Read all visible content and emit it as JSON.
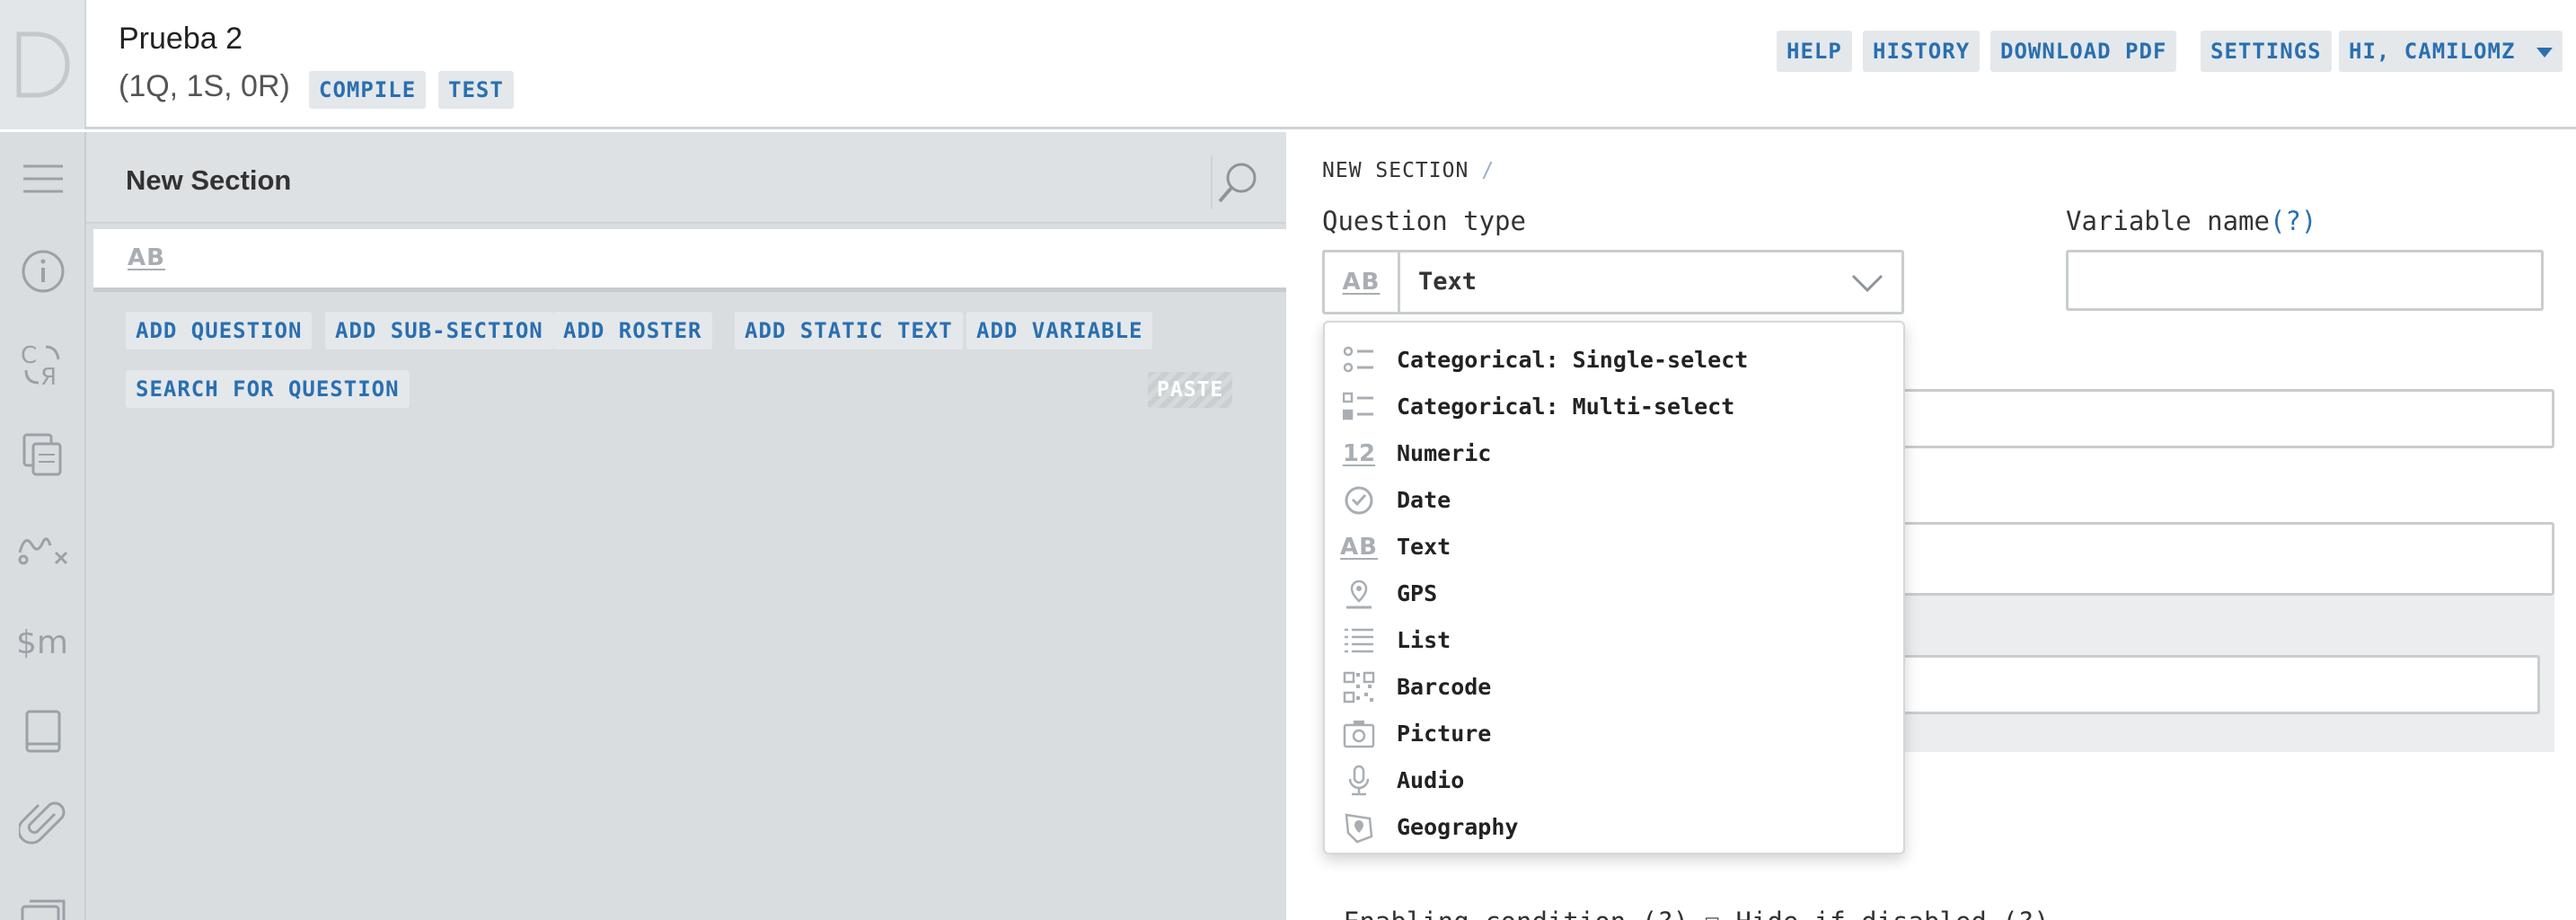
{
  "header": {
    "title": "Prueba 2",
    "counts": "(1Q, 1S, 0R)",
    "compile_label": "COMPILE",
    "test_label": "TEST",
    "nav": {
      "help": "HELP",
      "history": "HISTORY",
      "download_pdf": "DOWNLOAD PDF",
      "settings": "SETTINGS",
      "user": "HI, CAMILOMZ"
    }
  },
  "sidebar": {
    "icons": [
      "menu-icon",
      "info-icon",
      "translate-icon",
      "copy-icon",
      "macro-icon",
      "lookup-money-icon",
      "book-icon",
      "attachment-icon",
      "categories-icon"
    ]
  },
  "tree": {
    "section_title": "New Section",
    "item_icon": "AB",
    "actions": {
      "add_question": "ADD QUESTION",
      "add_subsection": "ADD SUB-SECTION",
      "add_roster": "ADD ROSTER",
      "add_static_text": "ADD STATIC TEXT",
      "add_variable": "ADD VARIABLE",
      "search_question": "SEARCH FOR QUESTION",
      "paste": "PASTE"
    }
  },
  "editor": {
    "breadcrumb": "NEW SECTION",
    "breadcrumb_sep": "/",
    "question_type_label": "Question type",
    "variable_name_label": "Variable name",
    "help_marker": "(?)",
    "selected_type_icon": "AB",
    "selected_type": "Text",
    "variable_name_value": "",
    "bottom_text": "Enabling condition (?)  ☐ Hide if disabled (?)"
  },
  "dropdown": {
    "options": [
      {
        "label": "Categorical: Single-select",
        "icon": "single-select-icon"
      },
      {
        "label": "Categorical: Multi-select",
        "icon": "multi-select-icon"
      },
      {
        "label": "Numeric",
        "icon": "numeric-icon",
        "glyph": "12"
      },
      {
        "label": "Date",
        "icon": "clock-icon"
      },
      {
        "label": "Text",
        "icon": "text-icon",
        "glyph": "AB"
      },
      {
        "label": "GPS",
        "icon": "location-pin-icon"
      },
      {
        "label": "List",
        "icon": "list-icon"
      },
      {
        "label": "Barcode",
        "icon": "barcode-icon"
      },
      {
        "label": "Picture",
        "icon": "camera-icon"
      },
      {
        "label": "Audio",
        "icon": "microphone-icon"
      },
      {
        "label": "Geography",
        "icon": "geography-icon"
      }
    ]
  },
  "colors": {
    "accent": "#2a6fb0",
    "tag_bg": "#e4e8eb",
    "panel_bg": "#d9dde0",
    "icon_grey": "#a8aeb3"
  }
}
